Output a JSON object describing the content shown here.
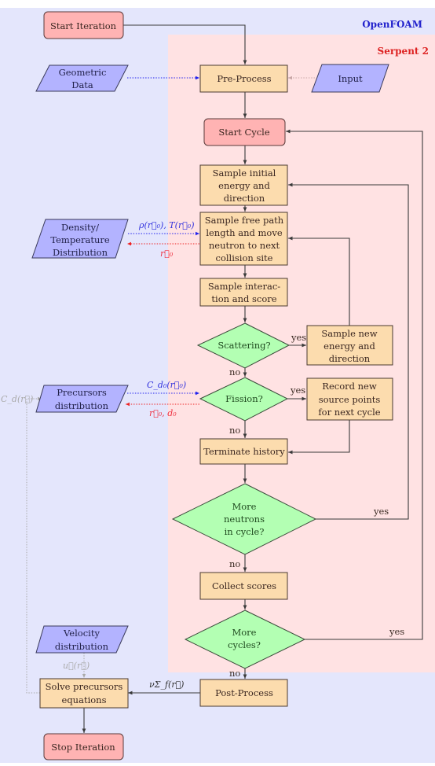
{
  "regions": {
    "outer": {
      "title": "OpenFOAM",
      "color": "#2222cc"
    },
    "inner": {
      "title": "Serpent 2",
      "color": "#dd2222"
    }
  },
  "colors": {
    "terminal_fill": "#ffb3b3",
    "process_fill": "#fcdcae",
    "decision_fill": "#b3ffb3",
    "io_fill": "#b3b3ff",
    "outer_bg": "#e4e6fc",
    "inner_bg": "#ffe2e3",
    "blue_arrow": "#2222ee",
    "red_arrow": "#ee2222",
    "gray_arrow": "#aaaaaa"
  },
  "nodes": {
    "start_iteration": "Start Iteration",
    "geometric_data": [
      "Geometric",
      "Data"
    ],
    "pre_process": "Pre-Process",
    "input": "Input",
    "start_cycle": "Start Cycle",
    "sample_initial": [
      "Sample initial",
      "energy and",
      "direction"
    ],
    "density_temp": [
      "Density/",
      "Temperature",
      "Distribution"
    ],
    "sample_free_path": [
      "Sample free path",
      "length and move",
      "neutron to next",
      "collision site"
    ],
    "sample_interaction": [
      "Sample interac-",
      "tion and score"
    ],
    "scattering": "Scattering?",
    "sample_new": [
      "Sample new",
      "energy and",
      "direction"
    ],
    "precursors": [
      "Precursors",
      "distribution"
    ],
    "fission": "Fission?",
    "record_new": [
      "Record new",
      "source points",
      "for next cycle"
    ],
    "terminate": "Terminate history",
    "more_neutrons": [
      "More",
      "neutrons",
      "in cycle?"
    ],
    "collect_scores": "Collect scores",
    "more_cycles": [
      "More",
      "cycles?"
    ],
    "velocity": [
      "Velocity",
      "distribution"
    ],
    "solve_precursors": [
      "Solve precursors",
      "equations"
    ],
    "post_process": "Post-Process",
    "stop_iteration": "Stop Iteration"
  },
  "edge_labels": {
    "yes": "yes",
    "no": "no",
    "rho_T": "ρ(r⃗₀),  T(r⃗₀)",
    "r0": "r⃗₀",
    "cd0": "C_d₀(r⃗₀)",
    "r0_d0": "r⃗₀,  d₀",
    "cd_r": "C_d(r⃗)",
    "u_r": "u⃗(r⃗)",
    "nu_sigma": "νΣ_f(r⃗)"
  }
}
